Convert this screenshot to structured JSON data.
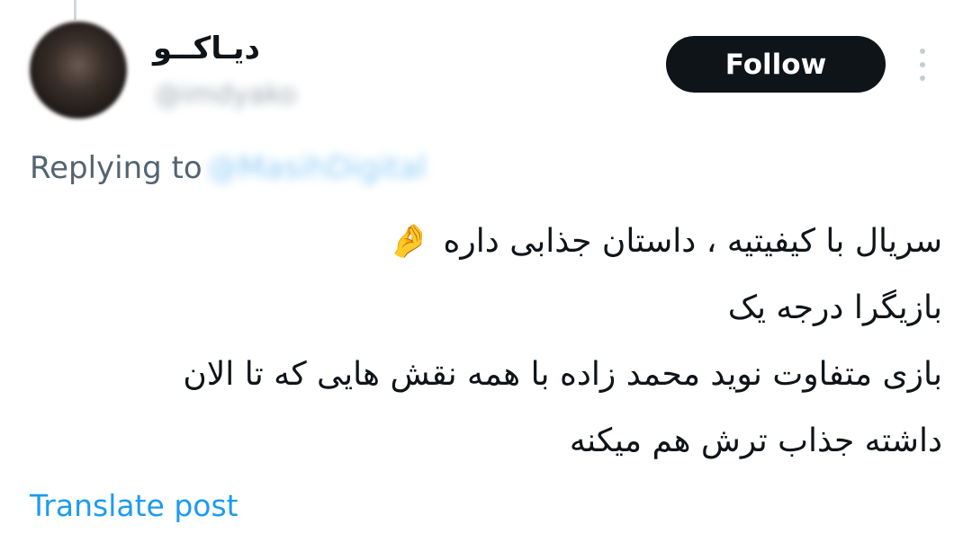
{
  "author": {
    "display_name": "دیـاکــو",
    "handle": "@imdyako",
    "avatar_icon": "avatar-image"
  },
  "follow_button": {
    "label": "Follow"
  },
  "more_menu": {
    "icon": "more-vertical-icon"
  },
  "reply_context": {
    "prefix": "Replying to",
    "handle": "@MasihDigital"
  },
  "tweet": {
    "lines": [
      "سریال با کیفیتیه ، داستان جذابی داره",
      "بازیگرا درجه یک",
      "بازی متفاوت نوید محمد زاده با همه نقش هایی که تا الان",
      "داشته جذاب ترش هم میکنه"
    ],
    "emoji": "🤌",
    "emoji_name": "pinched-fingers-icon"
  },
  "translate": {
    "label": "Translate post"
  },
  "colors": {
    "text": "#0f1419",
    "secondary": "#536471",
    "link": "#1d9bf0",
    "button_bg": "#0f1419",
    "button_text": "#ffffff"
  }
}
